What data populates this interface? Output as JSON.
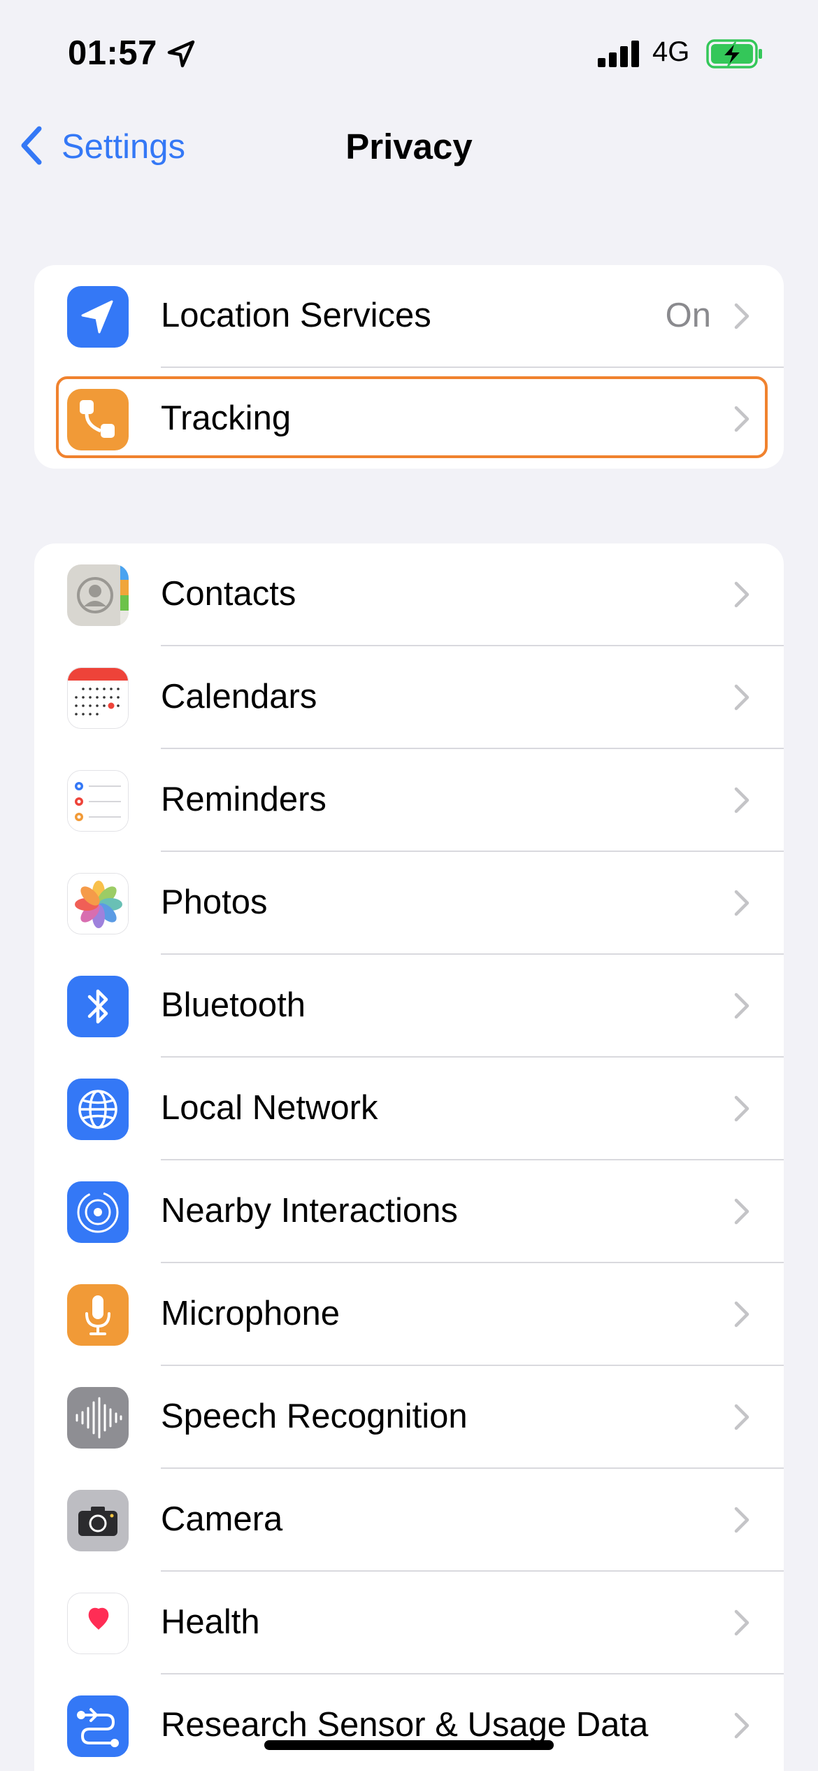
{
  "status_bar": {
    "time": "01:57",
    "network": "4G",
    "battery_color": "#34c759"
  },
  "nav": {
    "back_label": "Settings",
    "title": "Privacy"
  },
  "group1": [
    {
      "label": "Location Services",
      "value": "On",
      "icon": "location-arrow-icon",
      "color": "#3478f6"
    },
    {
      "label": "Tracking",
      "value": "",
      "icon": "tracking-icon",
      "color": "#f19a37",
      "highlighted": true
    }
  ],
  "group2": [
    {
      "label": "Contacts",
      "icon": "contacts-icon"
    },
    {
      "label": "Calendars",
      "icon": "calendar-icon"
    },
    {
      "label": "Reminders",
      "icon": "reminders-icon"
    },
    {
      "label": "Photos",
      "icon": "photos-icon"
    },
    {
      "label": "Bluetooth",
      "icon": "bluetooth-icon",
      "color": "#3478f6"
    },
    {
      "label": "Local Network",
      "icon": "globe-icon",
      "color": "#3478f6"
    },
    {
      "label": "Nearby Interactions",
      "icon": "nearby-icon",
      "color": "#3478f6"
    },
    {
      "label": "Microphone",
      "icon": "microphone-icon",
      "color": "#f19a37"
    },
    {
      "label": "Speech Recognition",
      "icon": "waveform-icon",
      "color": "#8e8e93"
    },
    {
      "label": "Camera",
      "icon": "camera-icon",
      "color": "#8e8e93"
    },
    {
      "label": "Health",
      "icon": "heart-icon",
      "color": "#ff2d55"
    },
    {
      "label": "Research Sensor & Usage Data",
      "icon": "research-icon",
      "color": "#3478f6"
    }
  ],
  "colors": {
    "accent": "#3478f6",
    "highlight_border": "#f0822e",
    "background": "#f2f2f7"
  }
}
